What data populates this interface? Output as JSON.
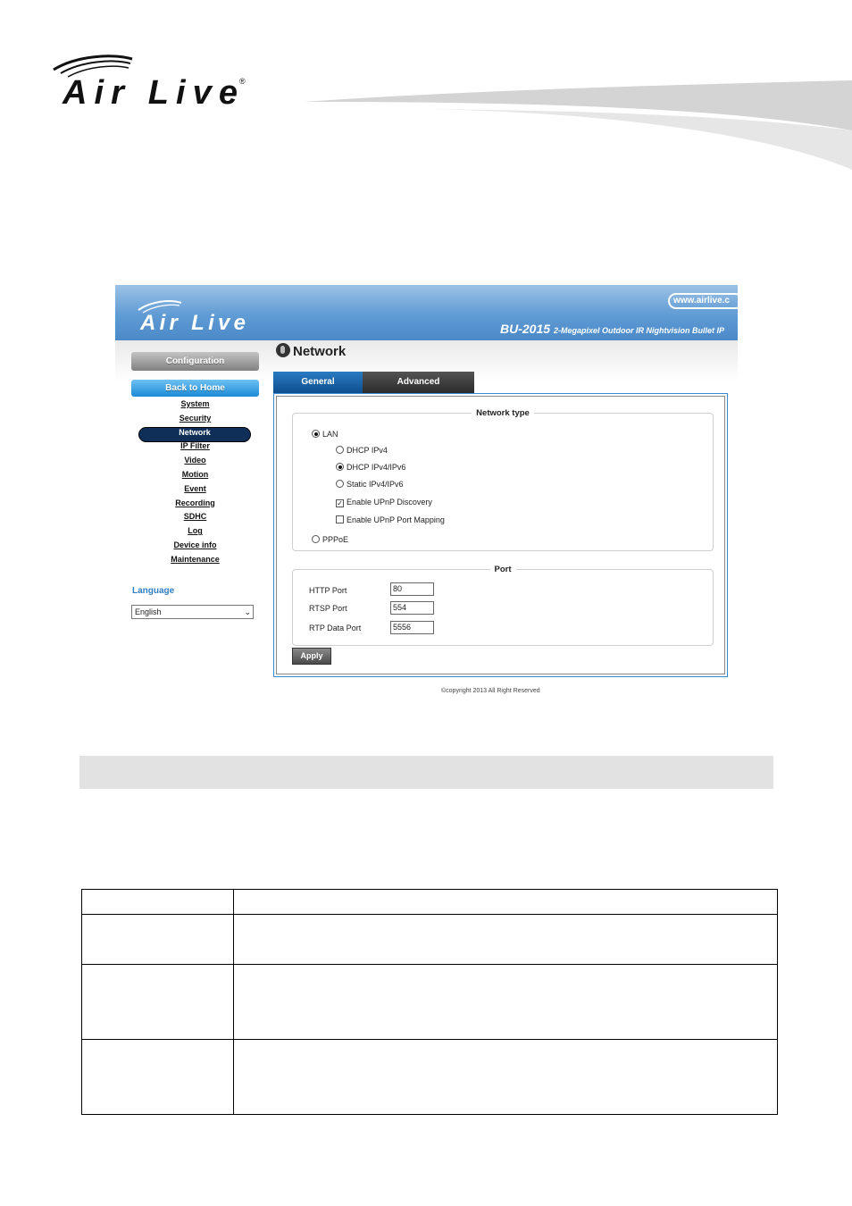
{
  "doc_header": {
    "brand": "Air Live"
  },
  "web_ui": {
    "banner": {
      "url": "www.airlive.c",
      "model": "BU-2015",
      "model_desc": "2-Megapixel Outdoor IR Nightvision Bullet IP",
      "logo_text": "Air Live"
    },
    "sidebar": {
      "config_label": "Configuration",
      "home_label": "Back to Home",
      "menu": [
        "System",
        "Security",
        "Network",
        "IP Filter",
        "Video",
        "Motion",
        "Event",
        "Recording",
        "SDHC",
        "Log",
        "Device info",
        "Maintenance"
      ],
      "active_item": "Network",
      "language_label": "Language",
      "language_value": "English"
    },
    "page_title": "Network",
    "tabs": {
      "general": "General",
      "advanced": "Advanced"
    },
    "network_type": {
      "legend": "Network type",
      "lan": "LAN",
      "dhcp_ipv4": "DHCP IPv4",
      "dhcp_ipv4_ipv6": "DHCP IPv4/IPv6",
      "static": "Static IPv4/IPv6",
      "upnp_discovery": "Enable UPnP Discovery",
      "upnp_port_mapping": "Enable UPnP Port Mapping",
      "pppoe": "PPPoE"
    },
    "port": {
      "legend": "Port",
      "http_label": "HTTP Port",
      "http_value": "80",
      "rtsp_label": "RTSP Port",
      "rtsp_value": "554",
      "rtp_label": "RTP Data Port",
      "rtp_value": "5556"
    },
    "apply_label": "Apply",
    "copyright": "©copyright 2013 All Right Reserved"
  }
}
